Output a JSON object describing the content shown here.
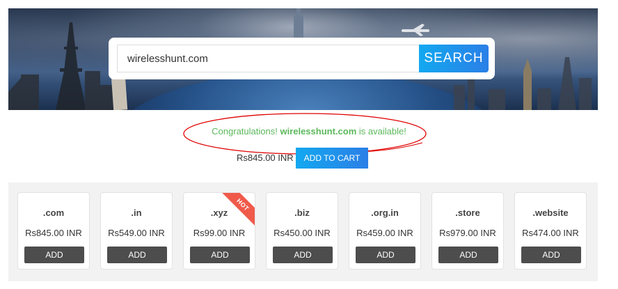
{
  "search": {
    "value": "wirelesshunt.com",
    "button_label": "SEARCH"
  },
  "result": {
    "prefix": "Congratulations! ",
    "domain": "wirelesshunt.com",
    "suffix": " is available!",
    "price": "Rs845.00 INR",
    "cart_label": "ADD TO CART",
    "accent_color": "#5cb85c",
    "annotation_color": "#e00000"
  },
  "tlds": [
    {
      "tld": ".com",
      "price": "Rs845.00 INR",
      "button": "ADD"
    },
    {
      "tld": ".in",
      "price": "Rs549.00 INR",
      "button": "ADD"
    },
    {
      "tld": ".xyz",
      "price": "Rs99.00 INR",
      "button": "ADD",
      "badge": "HOT"
    },
    {
      "tld": ".biz",
      "price": "Rs450.00 INR",
      "button": "ADD"
    },
    {
      "tld": ".org.in",
      "price": "Rs459.00 INR",
      "button": "ADD"
    },
    {
      "tld": ".store",
      "price": "Rs979.00 INR",
      "button": "ADD"
    },
    {
      "tld": ".website",
      "price": "Rs474.00 INR",
      "button": "ADD"
    }
  ],
  "colors": {
    "button_gradient_start": "#13a8f0",
    "button_gradient_end": "#2b7fe6",
    "add_button": "#4d4d4d",
    "hot_badge": "#f05a4a"
  }
}
